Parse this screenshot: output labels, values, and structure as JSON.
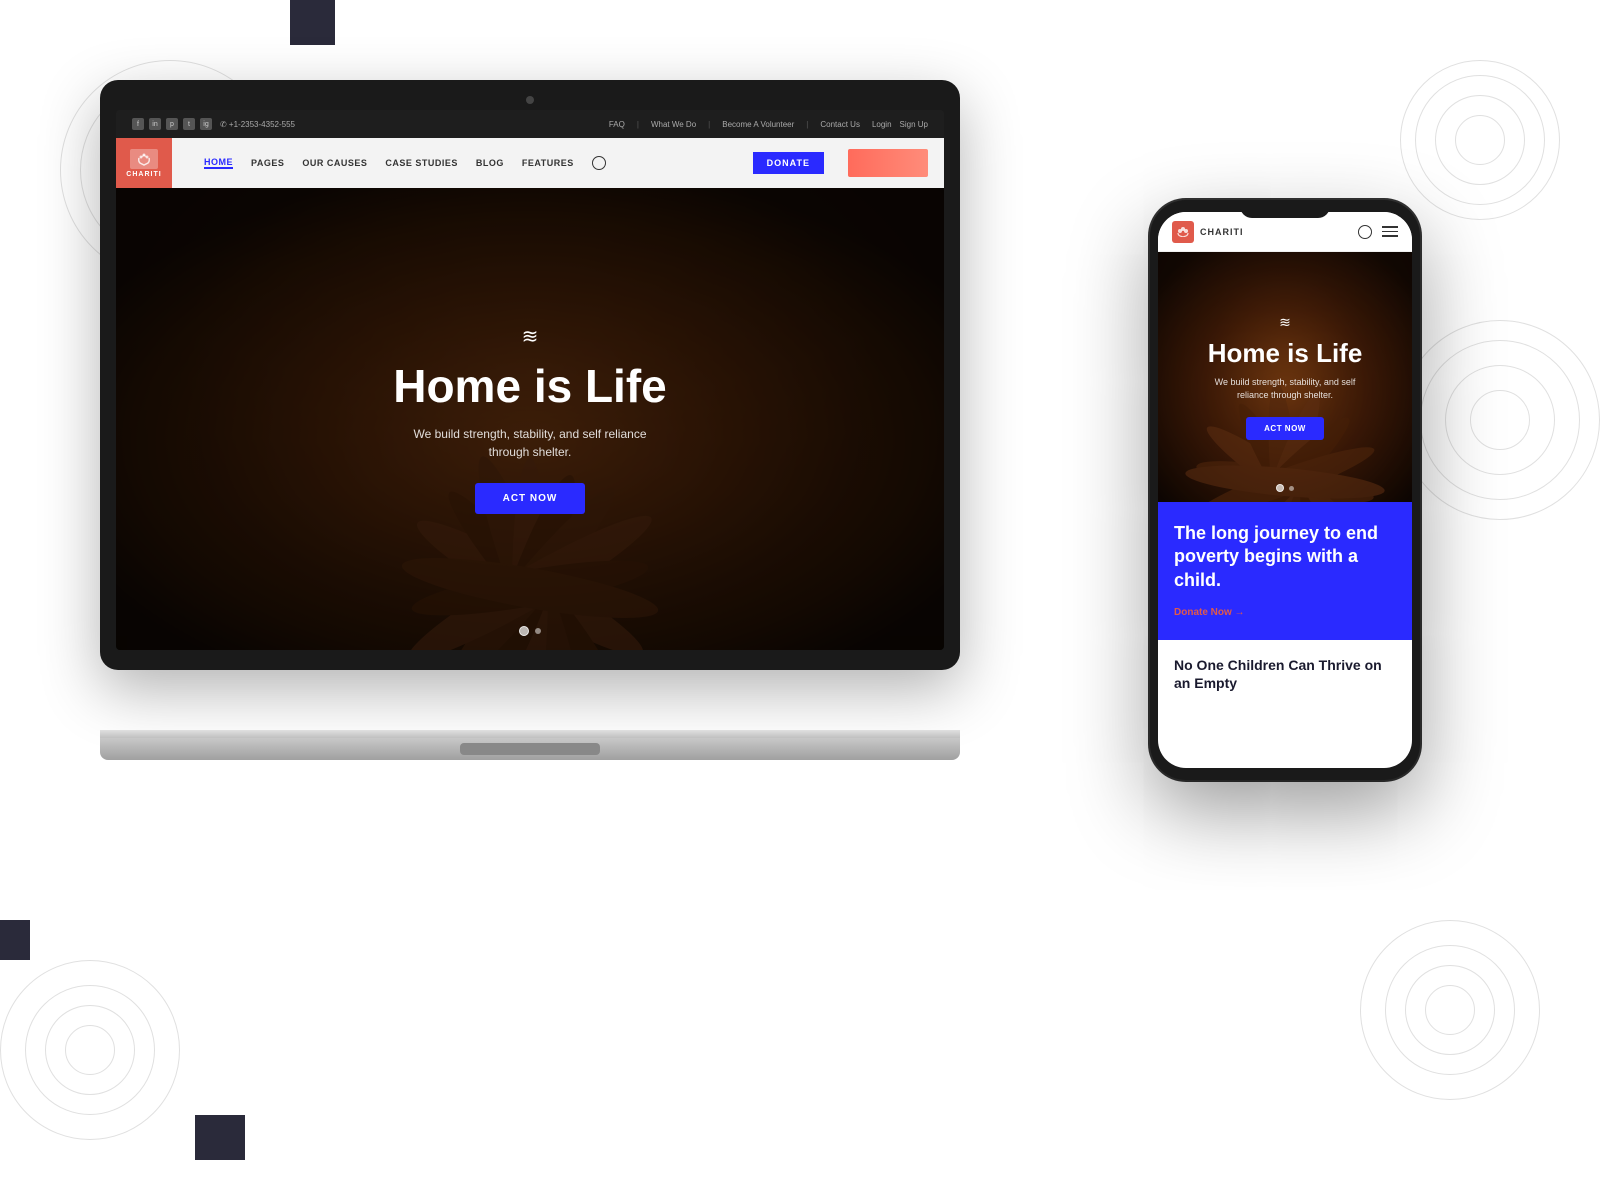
{
  "background": {
    "color": "#ffffff"
  },
  "decorations": {
    "squares": [
      {
        "id": "sq1",
        "position": "top-center"
      },
      {
        "id": "sq2",
        "position": "mid-right"
      },
      {
        "id": "sq3",
        "position": "mid-left"
      },
      {
        "id": "sq4",
        "position": "bottom-left"
      }
    ]
  },
  "laptop": {
    "website": {
      "topbar": {
        "social_icons": [
          "f",
          "in",
          "p",
          "t",
          "ig"
        ],
        "phone": "✆ +1-2353-4352-555",
        "nav_items": [
          "FAQ",
          "What We Do",
          "Become A Volunteer",
          "Contact Us"
        ],
        "login_label": "Login",
        "signup_label": "Sign Up"
      },
      "navbar": {
        "logo_text": "CHARITI",
        "nav_links": [
          "HOME",
          "PAGES",
          "OUR CAUSES",
          "CASE STUDIES",
          "BLOG",
          "FEATURES"
        ],
        "active_link": "HOME",
        "donate_label": "DONATE"
      },
      "hero": {
        "wave_symbol": "≋",
        "title": "Home is Life",
        "subtitle": "We build strength, stability, and self reliance\nthrough shelter.",
        "cta_label": "Act Now",
        "dot_count": 2
      },
      "bottom_bar": {
        "color": "#2a2aff"
      }
    }
  },
  "phone": {
    "website": {
      "navbar": {
        "logo_text": "CHARITI",
        "search_label": "search",
        "menu_label": "menu"
      },
      "hero": {
        "wave_symbol": "≋",
        "title": "Home is Life",
        "subtitle": "We build strength, stability, and self\nreliance through shelter.",
        "cta_label": "Act Now"
      },
      "blue_section": {
        "title": "The long journey to end poverty begins with a child.",
        "donate_label": "Donate Now →"
      },
      "white_section": {
        "title": "No One Children Can Thrive on an Empty"
      }
    }
  }
}
